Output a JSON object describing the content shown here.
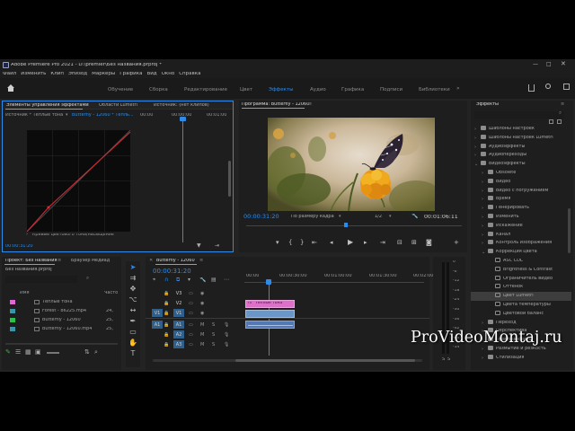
{
  "app": {
    "title": "Adobe Premiere Pro 2021 - D:\\premier\\Без названия.prproj *"
  },
  "menu": [
    "Файл",
    "Изменить",
    "Клип",
    "Эпизод",
    "Маркеры",
    "Графика",
    "Вид",
    "Окно",
    "Справка"
  ],
  "workspaces": {
    "items": [
      "Обучение",
      "Сборка",
      "Редактирование",
      "Цвет",
      "Эффекты",
      "Аудио",
      "Графика",
      "Подписи",
      "Библиотеки"
    ],
    "active": "Эффекты"
  },
  "effect_controls": {
    "tabs": [
      "Элементы управления эффектами",
      "Области Lumetri",
      "Источник: (нет клипов)"
    ],
    "source": "Источник * Теплые тона",
    "clip": "Butterfly - 12060 * Тепль...",
    "time_start": "00:00",
    "time_mid": "00:00:00",
    "time_end": "00:01:00",
    "curve_label": "Кривые цветового тона/насыщение",
    "timecode": "00:00:31:20"
  },
  "program": {
    "title": "Программа: Butterfly - 12060",
    "timecode": "00:00:31:20",
    "fit": "По размеру кадра",
    "quality": "1/2",
    "duration": "00:01:06:11"
  },
  "project": {
    "tabs": [
      "Проект: Без названия",
      "Браузер медиад"
    ],
    "file": "Без названия.prproj",
    "col_name": "Имя",
    "col_rate": "Часто",
    "items": [
      {
        "name": "Теплые тона",
        "rate": "",
        "color": "#e067d4"
      },
      {
        "name": "Forest - 86225.mp4",
        "rate": "24,",
        "color": "#3b95a8"
      },
      {
        "name": "Butterfly - 12060",
        "rate": "25,",
        "color": "#2ac24a"
      },
      {
        "name": "Butterfly - 12060.mp4",
        "rate": "25,",
        "color": "#3b95a8"
      }
    ]
  },
  "timeline": {
    "tab": "Butterfly - 12060",
    "timecode": "00:00:31:20",
    "ruler": [
      "00:00",
      "00:00:30:00",
      "00:01:00:00",
      "00:01:30:00",
      "00:02:00:00"
    ],
    "video_tracks": [
      "V3",
      "V2",
      "V1"
    ],
    "audio_tracks": [
      "A1",
      "A2",
      "A3"
    ],
    "clip_adjust": "Теплые тона",
    "track_btn_m": "M",
    "track_btn_s": "S",
    "src_v": "V1",
    "src_a": "A1"
  },
  "meter": {
    "labels": [
      "0",
      "-6",
      "-12",
      "-18",
      "-24",
      "-30",
      "-36",
      "-42",
      "-48",
      "-54"
    ],
    "bottom_s": "S",
    "bottom_s2": "S"
  },
  "effects": {
    "title": "Эффекты",
    "items": [
      {
        "label": "Шаблоны настроек",
        "level": 0,
        "type": "folder",
        "open": false
      },
      {
        "label": "Шаблоны настроек Lumetri",
        "level": 0,
        "type": "folder",
        "open": false
      },
      {
        "label": "Аудиоэффекты",
        "level": 0,
        "type": "folder",
        "open": false
      },
      {
        "label": "Аудиопереходы",
        "level": 0,
        "type": "folder",
        "open": false
      },
      {
        "label": "Видеоэффекты",
        "level": 0,
        "type": "folder",
        "open": true
      },
      {
        "label": "Obsolete",
        "level": 1,
        "type": "folder",
        "open": false
      },
      {
        "label": "Видео",
        "level": 1,
        "type": "folder",
        "open": false
      },
      {
        "label": "Видео с погружением",
        "level": 1,
        "type": "folder",
        "open": false
      },
      {
        "label": "Время",
        "level": 1,
        "type": "folder",
        "open": false
      },
      {
        "label": "Генерировать",
        "level": 1,
        "type": "folder",
        "open": false
      },
      {
        "label": "Изменить",
        "level": 1,
        "type": "folder",
        "open": false
      },
      {
        "label": "Искажение",
        "level": 1,
        "type": "folder",
        "open": false
      },
      {
        "label": "Канал",
        "level": 1,
        "type": "folder",
        "open": false
      },
      {
        "label": "Контроль изображения",
        "level": 1,
        "type": "folder",
        "open": false
      },
      {
        "label": "Коррекция цвета",
        "level": 1,
        "type": "folder",
        "open": true
      },
      {
        "label": "ASC CDL",
        "level": 2,
        "type": "fx"
      },
      {
        "label": "Brightness & Contrast",
        "level": 2,
        "type": "fx"
      },
      {
        "label": "Ограничитель видео",
        "level": 2,
        "type": "fx"
      },
      {
        "label": "Оттенок",
        "level": 2,
        "type": "fx"
      },
      {
        "label": "Цвет Lumetri",
        "level": 2,
        "type": "fx",
        "selected": true
      },
      {
        "label": "Цвета температуры",
        "level": 2,
        "type": "fx"
      },
      {
        "label": "Цветовой баланс",
        "level": 2,
        "type": "fx"
      },
      {
        "label": "Переход",
        "level": 1,
        "type": "folder",
        "open": false
      },
      {
        "label": "Перспектива",
        "level": 1,
        "type": "folder",
        "open": false
      },
      {
        "label": "Преобразовать",
        "level": 1,
        "type": "folder",
        "open": false
      },
      {
        "label": "Размытие и резкость",
        "level": 1,
        "type": "folder",
        "open": false
      },
      {
        "label": "Стилизация",
        "level": 1,
        "type": "folder",
        "open": false
      }
    ]
  },
  "watermark": "ProVideoMontaj.ru",
  "colors": {
    "accent": "#2d8ceb",
    "curve": "#d52b36",
    "adjust_clip": "#dd70c8",
    "video_clip": "#6a96c8",
    "audio_clip": "#5279b5",
    "selected_track": "#2f5f8c"
  }
}
